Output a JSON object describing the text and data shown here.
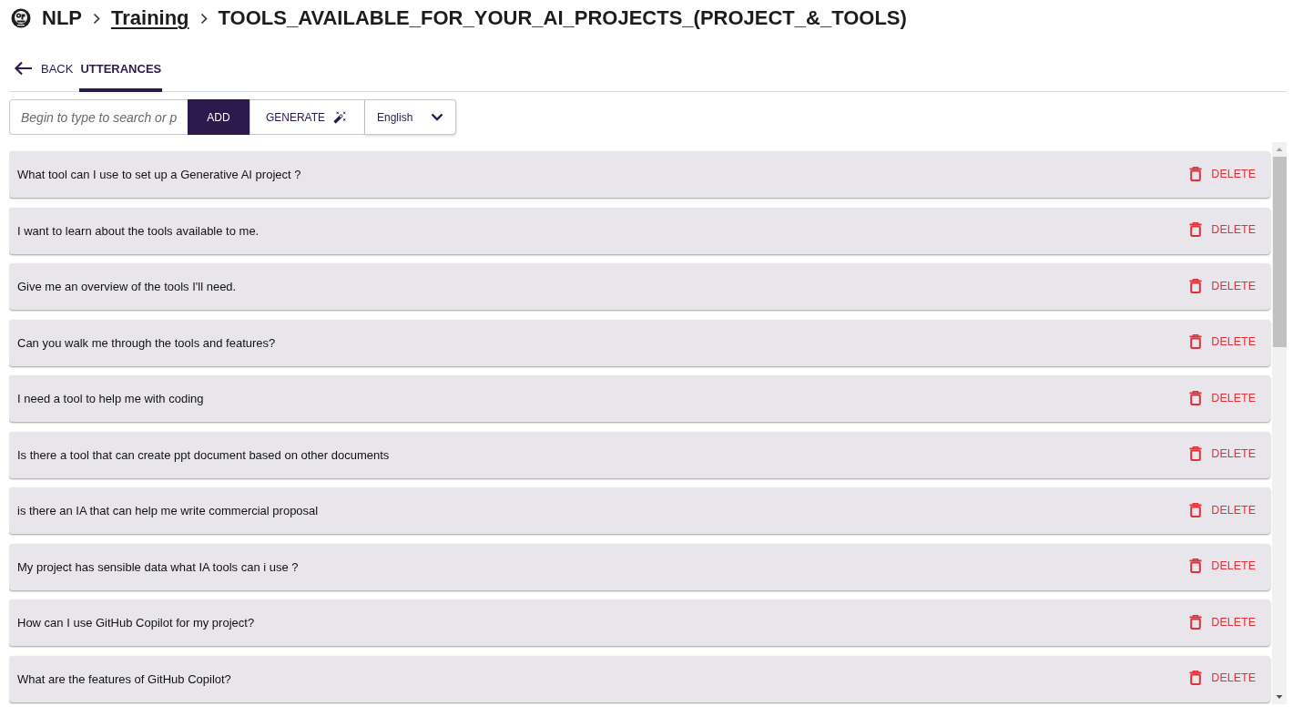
{
  "breadcrumb": {
    "root": "NLP",
    "link": "Training",
    "current": "TOOLS_AVAILABLE_FOR_YOUR_AI_PROJECTS_(PROJECT_&_TOOLS)"
  },
  "back_button": {
    "label": "BACK"
  },
  "tabs": [
    {
      "label": "UTTERANCES",
      "selected": true
    }
  ],
  "toolbar": {
    "search": {
      "placeholder": "Begin to type to search or p"
    },
    "buttons": [
      {
        "label": "ADD",
        "kind": "primary"
      },
      {
        "label": "GENERATE",
        "kind": "generate"
      }
    ],
    "language": {
      "value": "English"
    }
  },
  "utterances": [
    {
      "text": "What tool can I use to set up a Generative AI project ?",
      "action": "DELETE"
    },
    {
      "text": "I want to learn about the tools available to me.",
      "action": "DELETE"
    },
    {
      "text": "Give me an overview of the tools I'll need.",
      "action": "DELETE"
    },
    {
      "text": "Can you walk me through the tools and features?",
      "action": "DELETE"
    },
    {
      "text": "I need a tool to help me with coding",
      "action": "DELETE"
    },
    {
      "text": "Is there a tool that can create ppt document based on other documents",
      "action": "DELETE"
    },
    {
      "text": "is there an IA that can help me write commercial proposal",
      "action": "DELETE"
    },
    {
      "text": "My project has sensible data what IA tools can i use ?",
      "action": "DELETE"
    },
    {
      "text": "How can I use GitHub Copilot for my project?",
      "action": "DELETE"
    },
    {
      "text": "What are the features of GitHub Copilot?",
      "action": "DELETE"
    }
  ]
}
